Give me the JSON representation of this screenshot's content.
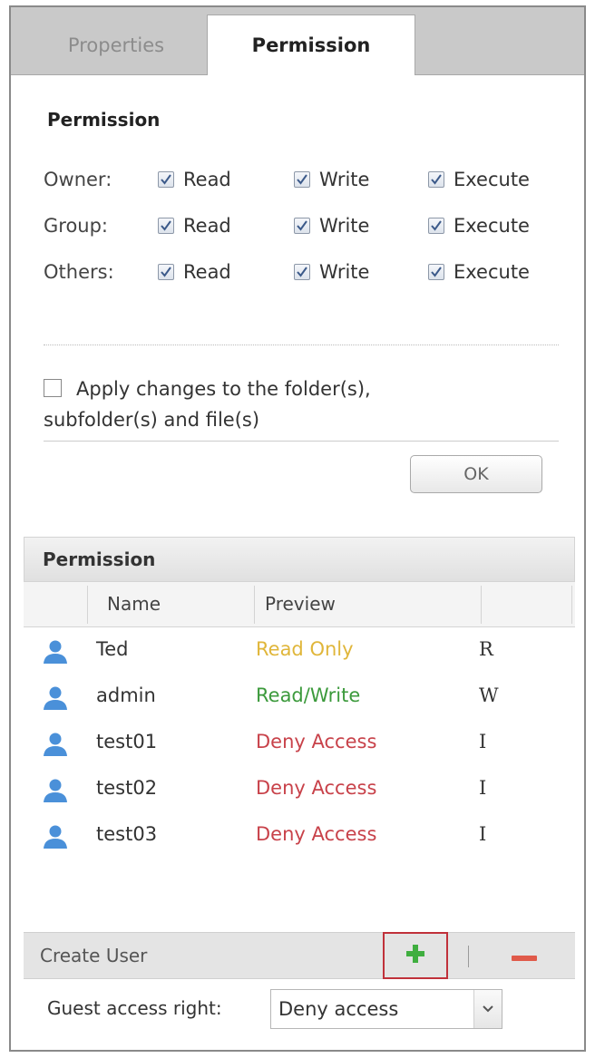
{
  "tabs": [
    {
      "label": "Properties",
      "active": false
    },
    {
      "label": "Permission",
      "active": true
    }
  ],
  "permission_section": {
    "title": "Permission",
    "rows": [
      {
        "label": "Owner:",
        "read": "Read",
        "write": "Write",
        "execute": "Execute",
        "read_checked": true,
        "write_checked": true,
        "execute_checked": true
      },
      {
        "label": "Group:",
        "read": "Read",
        "write": "Write",
        "execute": "Execute",
        "read_checked": true,
        "write_checked": true,
        "execute_checked": true
      },
      {
        "label": "Others:",
        "read": "Read",
        "write": "Write",
        "execute": "Execute",
        "read_checked": true,
        "write_checked": true,
        "execute_checked": true
      }
    ],
    "apply_changes": {
      "line1": "Apply changes to the folder(s),",
      "line2": "subfolder(s) and file(s)",
      "checked": false
    },
    "ok_label": "OK"
  },
  "user_grid": {
    "title": "Permission",
    "columns": {
      "name": "Name",
      "preview": "Preview"
    },
    "users": [
      {
        "name": "Ted",
        "preview": "Read Only",
        "flag": "R",
        "color": "#e0b63a"
      },
      {
        "name": "admin",
        "preview": "Read/Write",
        "flag": "W",
        "color": "#3c9a3c"
      },
      {
        "name": "test01",
        "preview": "Deny Access",
        "flag": "I",
        "color": "#c8424a"
      },
      {
        "name": "test02",
        "preview": "Deny Access",
        "flag": "I",
        "color": "#c8424a"
      },
      {
        "name": "test03",
        "preview": "Deny Access",
        "flag": "I",
        "color": "#c8424a"
      }
    ]
  },
  "footer": {
    "create_user_label": "Create User",
    "add_icon": "plus-icon",
    "remove_icon": "minus-icon"
  },
  "guest_access": {
    "label": "Guest access right:",
    "value": "Deny access"
  },
  "colors": {
    "user_icon": "#4a90d9",
    "add_green": "#3fae3f",
    "remove_red": "#e05a4a",
    "highlight_border": "#c0313a"
  }
}
